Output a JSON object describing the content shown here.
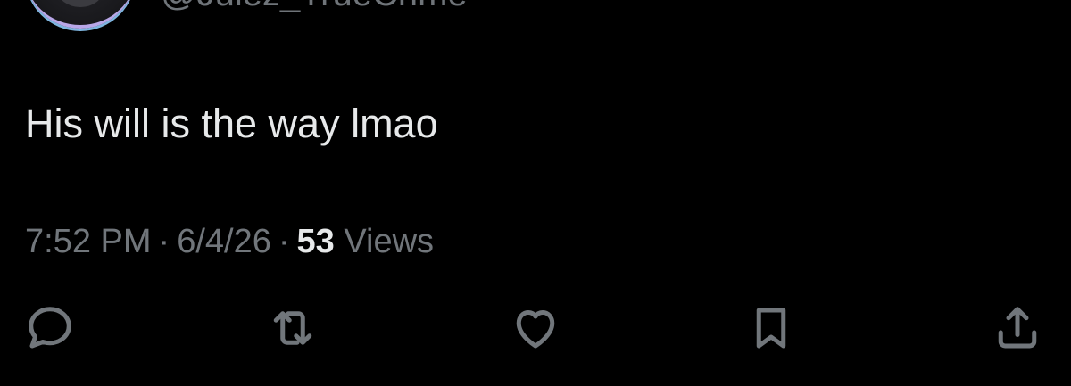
{
  "tweet": {
    "handle": "@Julez_TrueCrime",
    "text": "His will is the way lmao",
    "time": "7:52 PM",
    "date": "6/4/26",
    "views_count": "53",
    "views_label": "Views",
    "separator": "·"
  },
  "actions": [
    {
      "name": "reply",
      "icon": "speech-bubble-icon"
    },
    {
      "name": "repost",
      "icon": "repost-icon"
    },
    {
      "name": "like",
      "icon": "heart-icon"
    },
    {
      "name": "bookmark",
      "icon": "bookmark-icon"
    },
    {
      "name": "share",
      "icon": "share-icon"
    }
  ],
  "colors": {
    "background": "#000000",
    "text_primary": "#e7e9ea",
    "text_secondary": "#71767b"
  }
}
